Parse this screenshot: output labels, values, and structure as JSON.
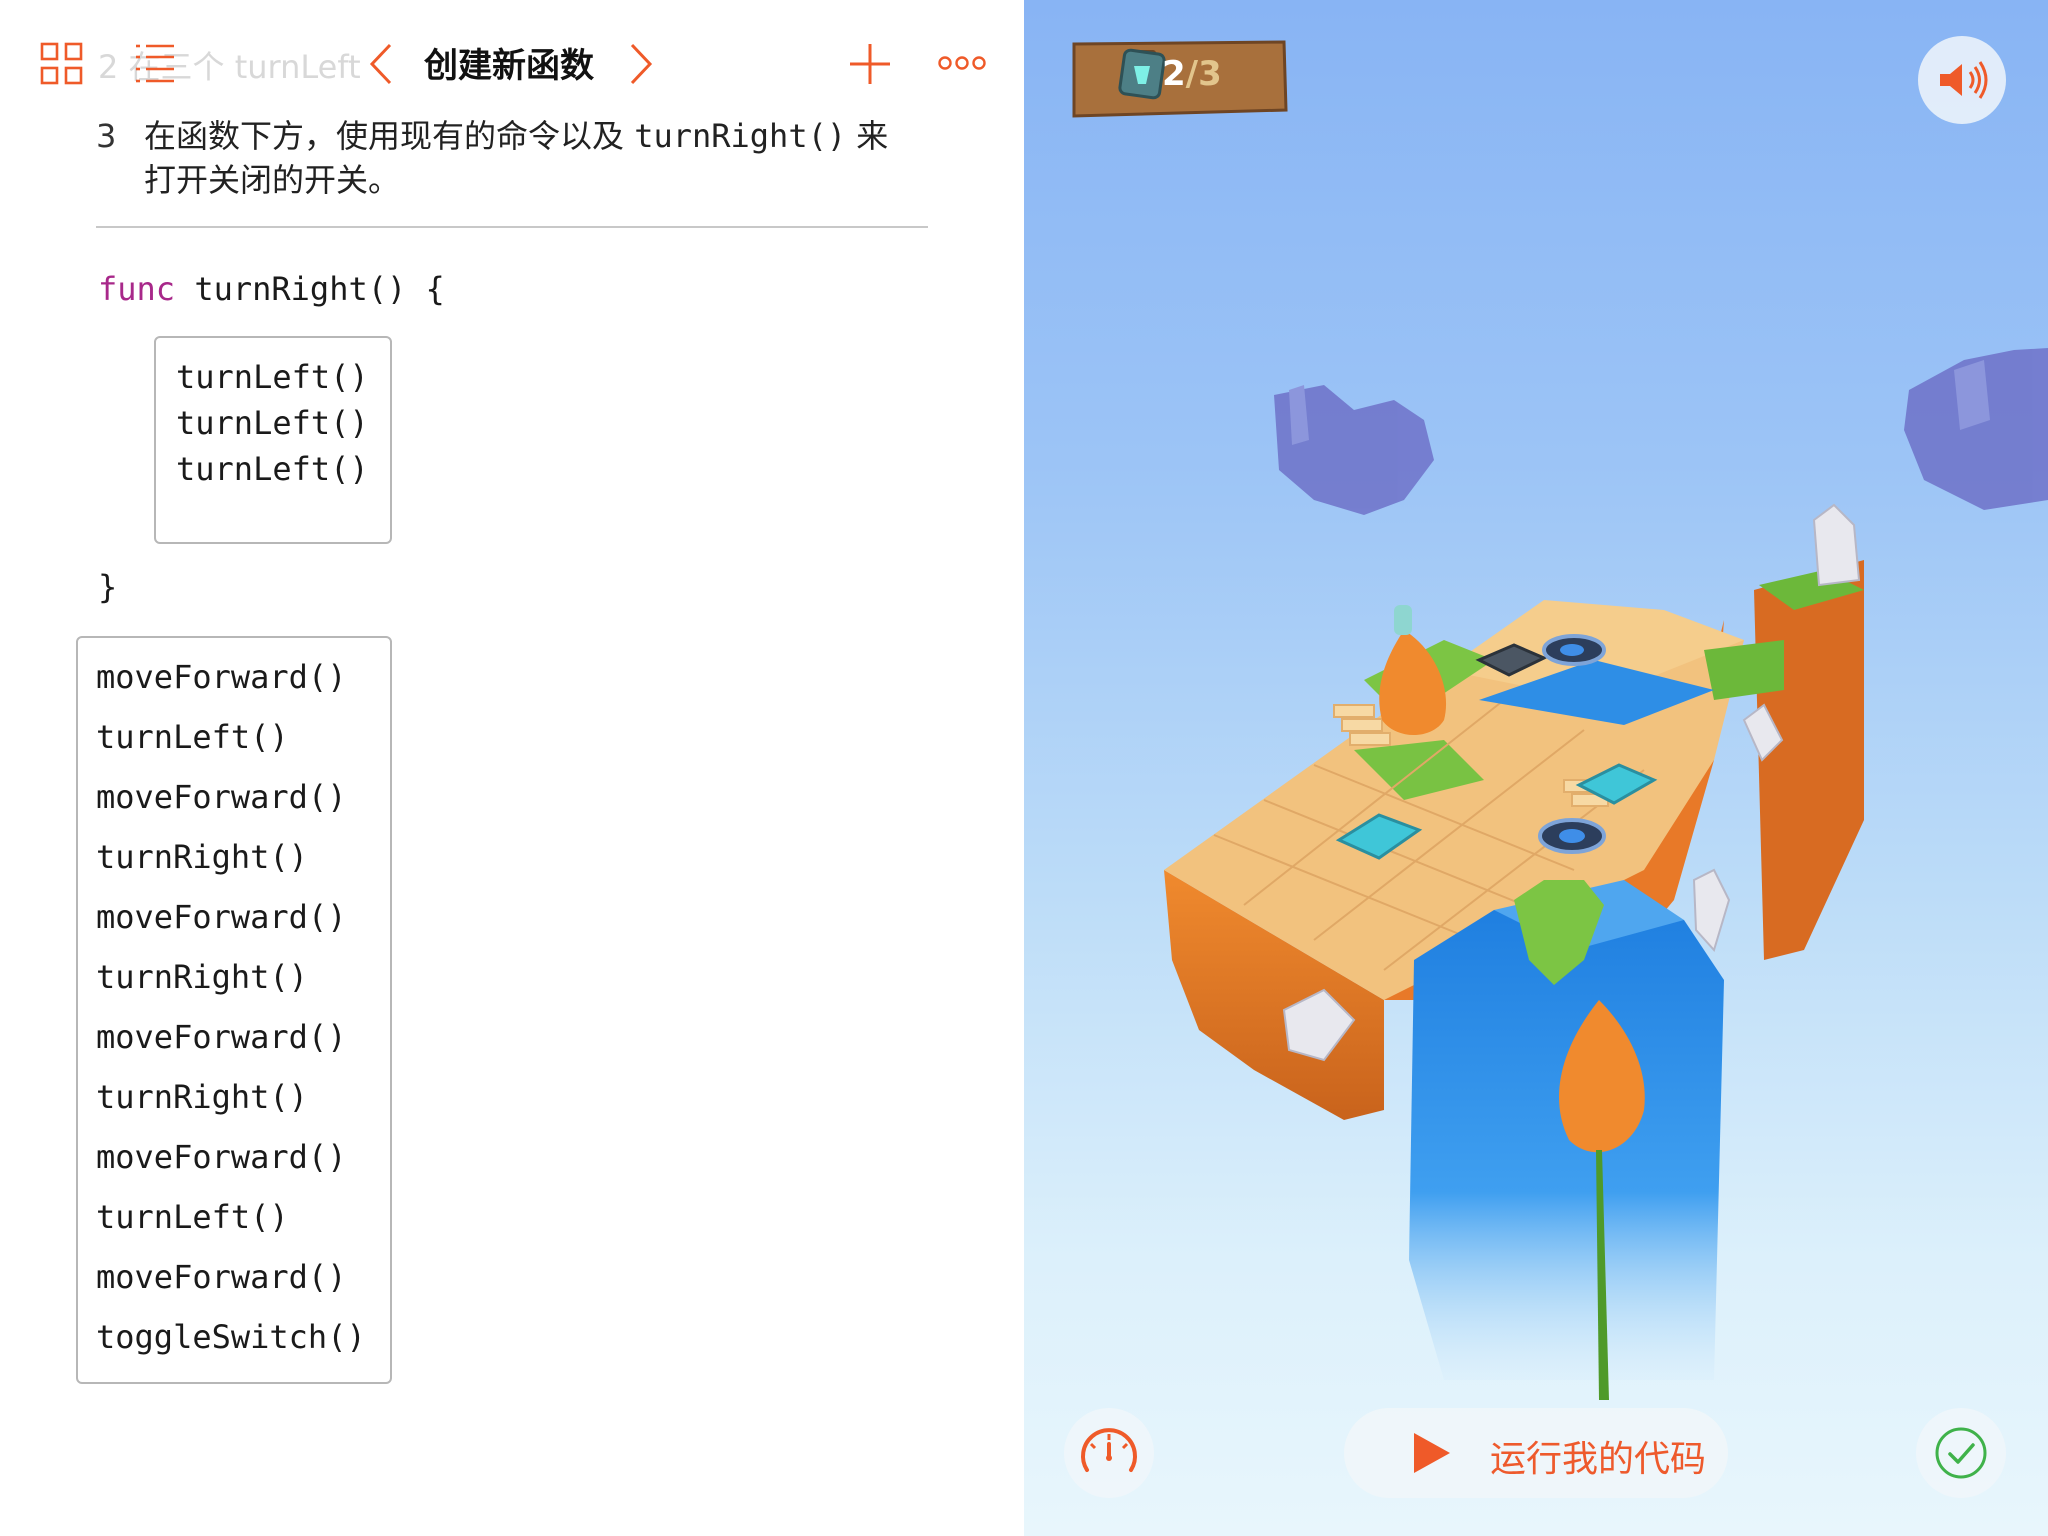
{
  "nav": {
    "title": "创建新函数",
    "ghost_step": "2  在三个 turnLeft"
  },
  "instructions": {
    "step_number": "3",
    "line1_prefix": "在函数下方，使用现有的命令以及 ",
    "line1_code": "turnRight()",
    "line1_suffix": " 来",
    "line2": "打开关闭的开关。"
  },
  "code": {
    "func_keyword": "func",
    "func_signature": " turnRight() {",
    "close_brace": "}",
    "function_body": [
      "turnLeft()",
      "turnLeft()",
      "turnLeft()"
    ],
    "main_body": [
      "moveForward()",
      "turnLeft()",
      "moveForward()",
      "turnRight()",
      "moveForward()",
      "turnRight()",
      "moveForward()",
      "turnRight()",
      "moveForward()",
      "turnLeft()",
      "moveForward()",
      "toggleSwitch()"
    ]
  },
  "game": {
    "progress_current": "2",
    "progress_sep": "/",
    "progress_total": "3",
    "run_label": "运行我的代码"
  },
  "icons": {
    "grid": "grid-icon",
    "list": "list-icon",
    "prev": "chevron-left-icon",
    "next": "chevron-right-icon",
    "add": "plus-icon",
    "more": "more-icon",
    "sound": "speaker-icon",
    "speed": "speedometer-icon",
    "play": "play-icon",
    "check": "checkmark-icon",
    "gem": "gem-icon"
  },
  "colors": {
    "accent": "#ef5a29",
    "keyword": "#a8288a",
    "check": "#3fb24a"
  }
}
